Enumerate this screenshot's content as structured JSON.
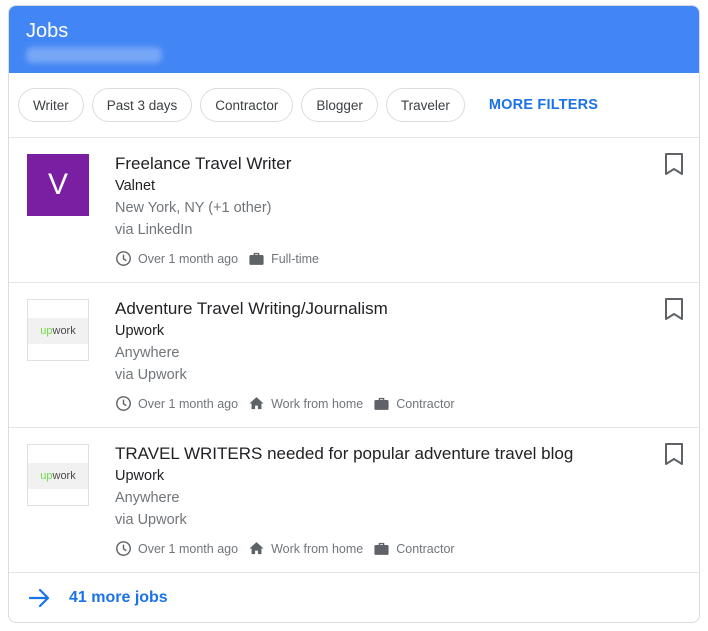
{
  "header": {
    "title": "Jobs"
  },
  "filters": {
    "chips": [
      "Writer",
      "Past 3 days",
      "Contractor",
      "Blogger",
      "Traveler"
    ],
    "more_label": "MORE FILTERS"
  },
  "jobs": [
    {
      "title": "Freelance Travel Writer",
      "company": "Valnet",
      "location": "New York, NY (+1 other)",
      "via": "via LinkedIn",
      "logo_letter": "V",
      "posted": "Over 1 month ago",
      "work_type": "",
      "employment": "Full-time"
    },
    {
      "title": "Adventure Travel Writing/Journalism",
      "company": "Upwork",
      "location": "Anywhere",
      "via": "via Upwork",
      "logo_text_accent": "up",
      "logo_text_rest": "work",
      "posted": "Over 1 month ago",
      "work_type": "Work from home",
      "employment": "Contractor"
    },
    {
      "title": "TRAVEL WRITERS needed for popular adventure travel blog",
      "company": "Upwork",
      "location": "Anywhere",
      "via": "via Upwork",
      "logo_text_accent": "up",
      "logo_text_rest": "work",
      "posted": "Over 1 month ago",
      "work_type": "Work from home",
      "employment": "Contractor"
    }
  ],
  "footer": {
    "more_jobs_label": "41 more jobs"
  },
  "colors": {
    "header_bg": "#4285f4",
    "accent": "#1a73e8",
    "valnet_logo": "#7b1fa2",
    "upwork_green": "#6fda44"
  },
  "icons": [
    "clock-icon",
    "briefcase-icon",
    "home-icon",
    "bookmark-icon",
    "arrow-right-icon"
  ]
}
